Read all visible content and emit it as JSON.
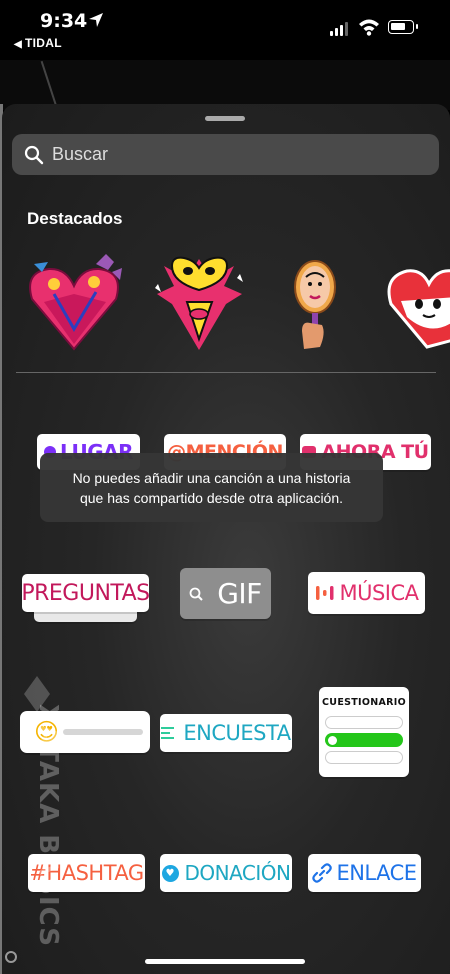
{
  "status_bar": {
    "time": "9:34",
    "back_app": "TIDAL",
    "icons": [
      "location-arrow-icon",
      "cellular-signal-icon",
      "wifi-icon",
      "battery-icon"
    ]
  },
  "search": {
    "placeholder": "Buscar",
    "icon": "search-icon"
  },
  "featured": {
    "title": "Destacados",
    "items": [
      "heart-flowers-sticker",
      "heart-face-sticker",
      "hand-mirror-sticker",
      "heart-character-sticker"
    ]
  },
  "stickers": {
    "lugar": "LUGAR",
    "mencion": "@MENCIÓN",
    "ahora_tu": "AHORA TÚ",
    "preguntas": "PREGUNTAS",
    "gif": "GIF",
    "musica": "MÚSICA",
    "slider_emoji": "😍",
    "encuesta": "ENCUESTA",
    "cuestionario": "CUESTIONARIO",
    "hashtag": "#HASHTAG",
    "donacion": "DONACIÓN",
    "enlace": "ENLACE"
  },
  "toast": {
    "line1": "No puedes añadir una canción a una historia",
    "line2": "que has compartido desde otra aplicación."
  },
  "watermark": "XATAKA BASICS",
  "colors": {
    "sheet": "#262626",
    "search": "#4a4a4a",
    "gif": "#8e8e8e",
    "quiz_green": "#24c61a"
  }
}
